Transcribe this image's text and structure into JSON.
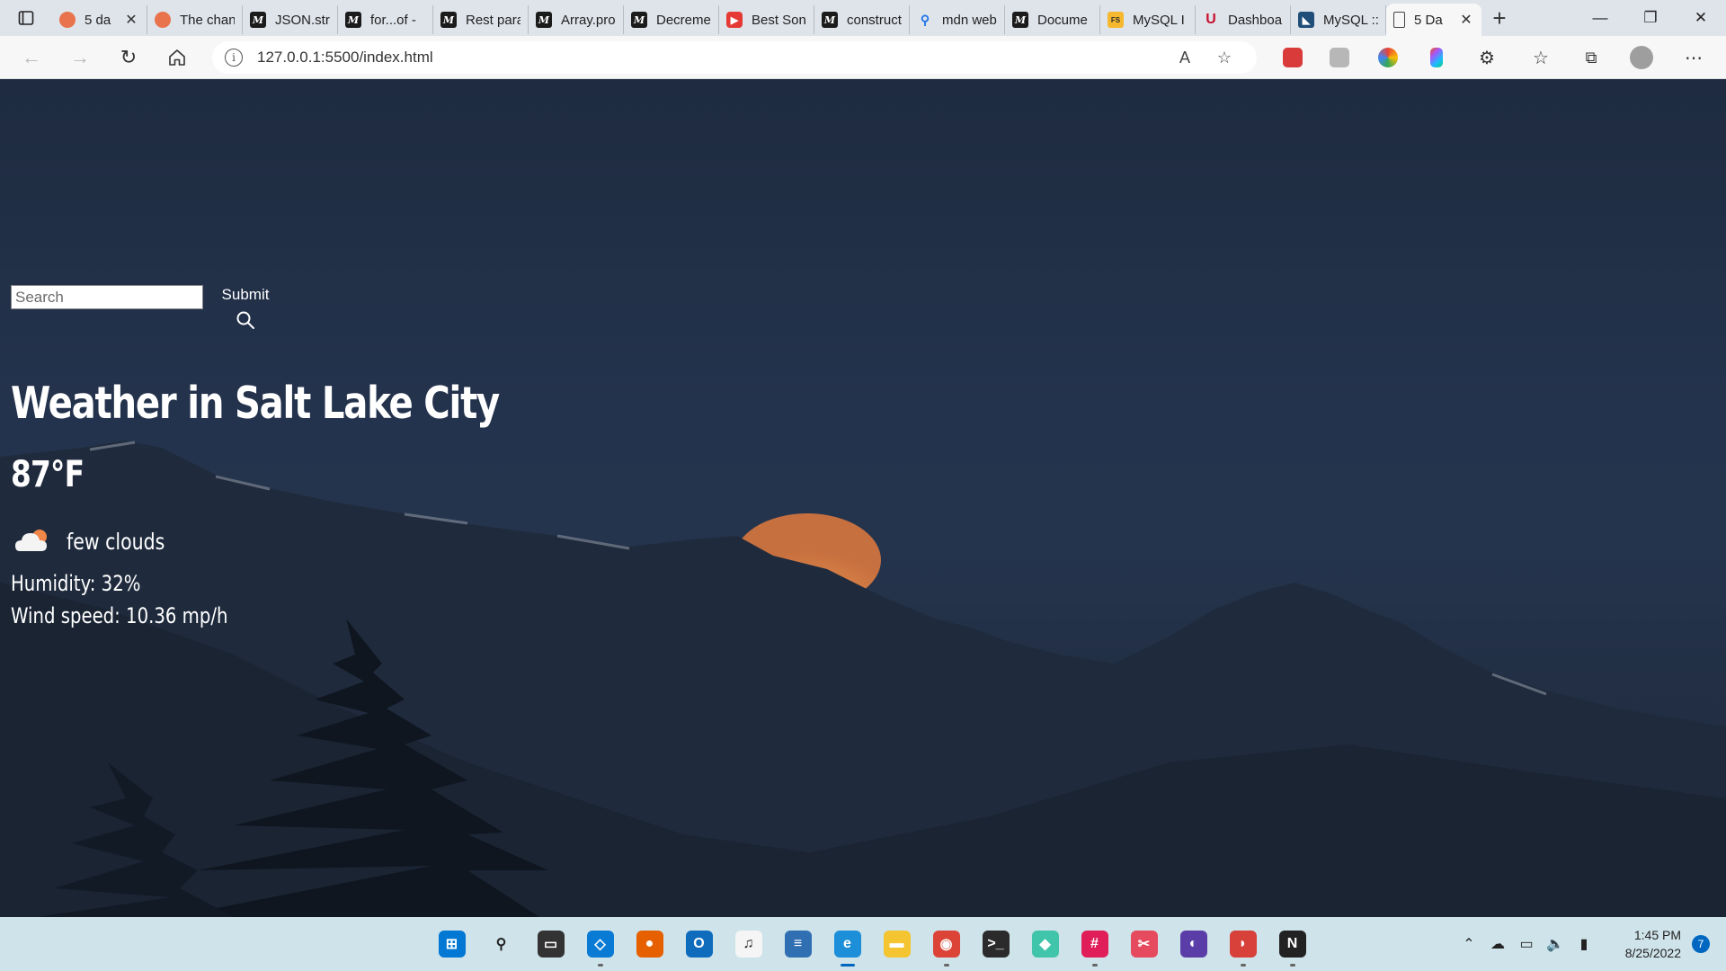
{
  "browser": {
    "tabs": [
      {
        "title": "5 da",
        "favicon": "orange-dot-icon",
        "closable": true
      },
      {
        "title": "The chan",
        "favicon": "orange-dot-icon"
      },
      {
        "title": "JSON.stri",
        "favicon": "mdn-icon"
      },
      {
        "title": "for...of -",
        "favicon": "mdn-icon"
      },
      {
        "title": "Rest para",
        "favicon": "mdn-icon"
      },
      {
        "title": "Array.pro",
        "favicon": "mdn-icon"
      },
      {
        "title": "Decreme",
        "favicon": "mdn-icon"
      },
      {
        "title": "Best Son",
        "favicon": "youtube-icon"
      },
      {
        "title": "construct",
        "favicon": "mdn-icon"
      },
      {
        "title": "mdn web",
        "favicon": "search-icon"
      },
      {
        "title": "Docume",
        "favicon": "mdn-icon"
      },
      {
        "title": "MySQL I",
        "favicon": "fs-icon"
      },
      {
        "title": "Dashboa",
        "favicon": "university-icon"
      },
      {
        "title": "MySQL ::",
        "favicon": "mysql-icon"
      },
      {
        "title": "5 Da",
        "favicon": "document-icon",
        "active": true,
        "closable": true
      }
    ],
    "address": "127.0.0.1:5500/index.html",
    "window_controls": {
      "minimize": "—",
      "restore": "❐",
      "close": "✕"
    },
    "new_tab_label": "+"
  },
  "search": {
    "placeholder": "Search",
    "submit_label": "Submit"
  },
  "weather": {
    "city_title": "Weather in Salt Lake City",
    "temperature": "87°F",
    "description": "few clouds",
    "humidity": "Humidity: 32%",
    "wind": "Wind speed: 10.36 mp/h"
  },
  "taskbar": {
    "apps": [
      {
        "name": "start-icon"
      },
      {
        "name": "search-icon"
      },
      {
        "name": "task-view-icon"
      },
      {
        "name": "vscode-icon",
        "running": true
      },
      {
        "name": "firefox-icon"
      },
      {
        "name": "outlook-icon"
      },
      {
        "name": "itunes-icon"
      },
      {
        "name": "notepad-icon"
      },
      {
        "name": "edge-icon",
        "active": true
      },
      {
        "name": "file-explorer-icon"
      },
      {
        "name": "chrome-icon",
        "running": true
      },
      {
        "name": "terminal-icon"
      },
      {
        "name": "gitkraken-icon"
      },
      {
        "name": "slack-icon",
        "running": true
      },
      {
        "name": "snipping-tool-icon"
      },
      {
        "name": "tor-icon"
      },
      {
        "name": "mysql-workbench-icon",
        "running": true
      },
      {
        "name": "notion-icon",
        "running": true
      }
    ],
    "time": "1:45 PM",
    "date": "8/25/2022",
    "notifications": "7"
  },
  "colors": {
    "page_bg": "#24334d",
    "taskbar_bg": "#cfe3ea",
    "moon": "#d9804a"
  }
}
